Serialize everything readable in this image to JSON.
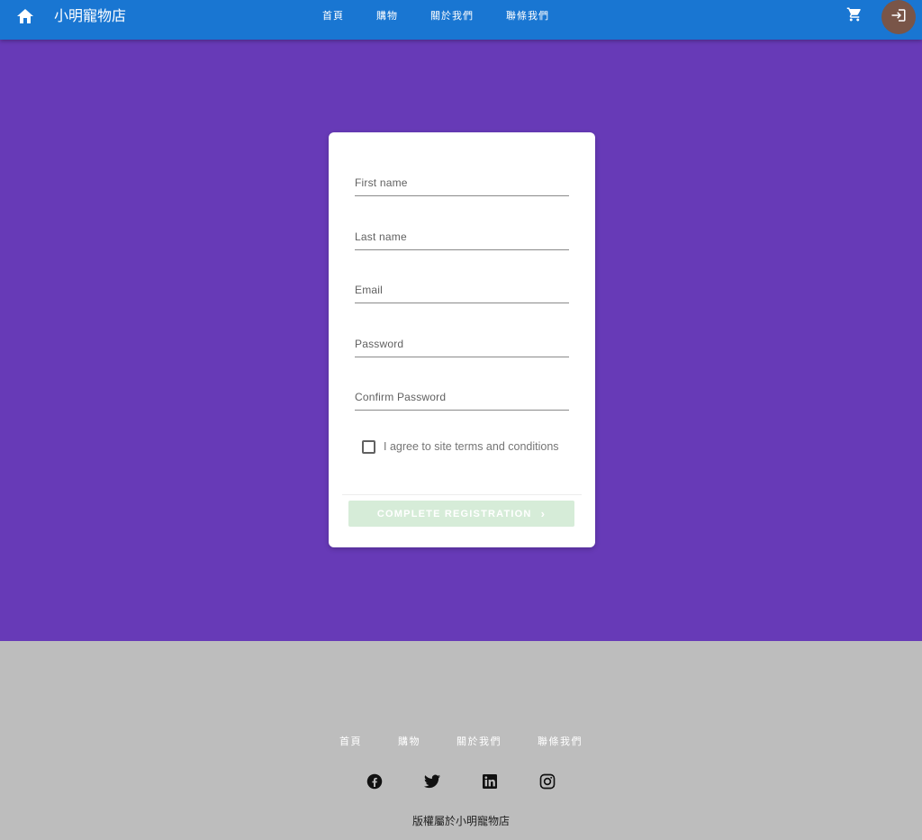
{
  "header": {
    "brand": "小明寵物店",
    "nav": [
      "首頁",
      "購物",
      "關於我們",
      "聯條我們"
    ],
    "home_icon": "home-icon",
    "cart_icon": "shopping-cart-icon",
    "login_icon": "login-icon",
    "login_bg": "#795548",
    "bar_color": "#1976d2"
  },
  "form": {
    "fields": [
      {
        "label": "First name"
      },
      {
        "label": "Last name"
      },
      {
        "label": "Email"
      },
      {
        "label": "Password"
      },
      {
        "label": "Confirm Password"
      }
    ],
    "agree_label": "I agree to site terms and conditions",
    "submit_label": "COMPLETE REGISTRATION",
    "submit_color": "#d6ecd8"
  },
  "footer": {
    "nav": [
      "首頁",
      "購物",
      "關於我們",
      "聯條我們"
    ],
    "social": [
      "facebook-icon",
      "twitter-icon",
      "linkedin-icon",
      "instagram-icon"
    ],
    "copyright": "版權屬於小明寵物店"
  },
  "colors": {
    "page_bg": "#673ab7",
    "footer_bg": "#bdbdbd"
  }
}
